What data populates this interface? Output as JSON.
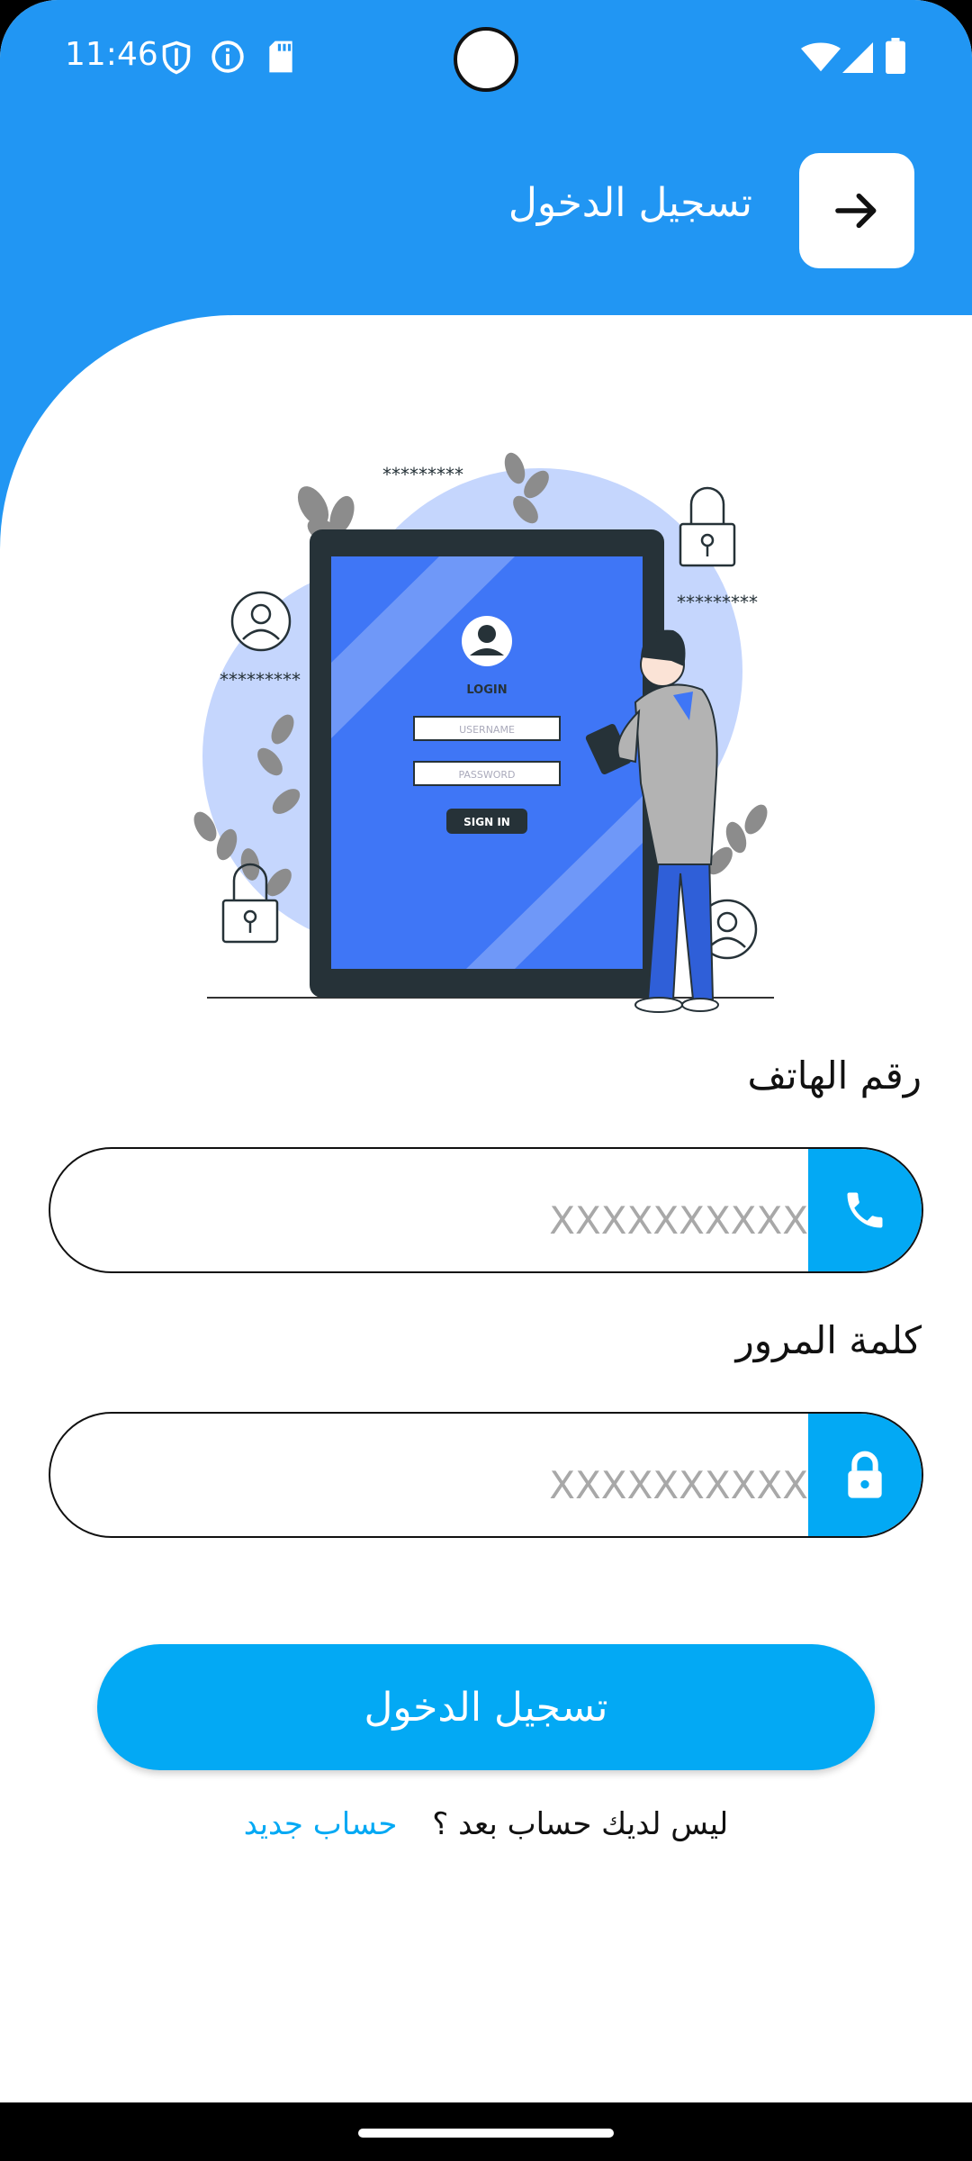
{
  "status_bar": {
    "time": "11:46"
  },
  "header": {
    "title": "تسجيل الدخول"
  },
  "illustration": {
    "login_title": "LOGIN",
    "username_placeholder": "USERNAME",
    "password_placeholder": "PASSWORD",
    "sign_in_label": "SIGN IN",
    "mask_text": "*********"
  },
  "form": {
    "phone_label": "رقم الهاتف",
    "phone_placeholder": "XXXXXXXXXX",
    "password_label": "كلمة المرور",
    "password_placeholder": "XXXXXXXXXX",
    "submit_label": "تسجيل الدخول",
    "no_account_text": "ليس لديك حساب بعد ؟",
    "new_account_link": "حساب جديد"
  },
  "colors": {
    "header_blue": "#2196F3",
    "accent_blue": "#03A9F4"
  }
}
